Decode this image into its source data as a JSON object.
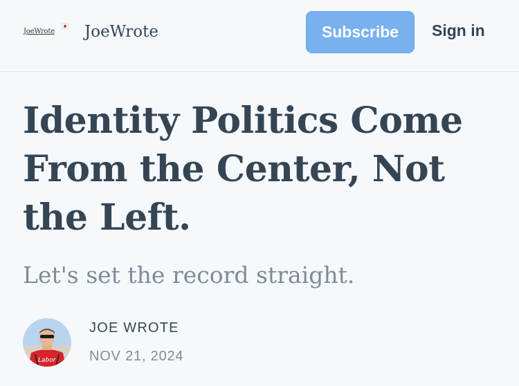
{
  "header": {
    "logo_text": "JoeWrote",
    "publication_name": "JoeWrote",
    "subscribe_label": "Subscribe",
    "signin_label": "Sign in"
  },
  "article": {
    "title": "Identity Politics Come From the Center, Not the Left.",
    "subtitle": "Let's set the record straight.",
    "author": "JOE WROTE",
    "date": "NOV 21, 2024",
    "avatar_shirt_text": "Labor"
  },
  "colors": {
    "background": "#f6f9fc",
    "text": "#364554",
    "muted": "#7f8b96",
    "accent": "#79b0ee"
  }
}
